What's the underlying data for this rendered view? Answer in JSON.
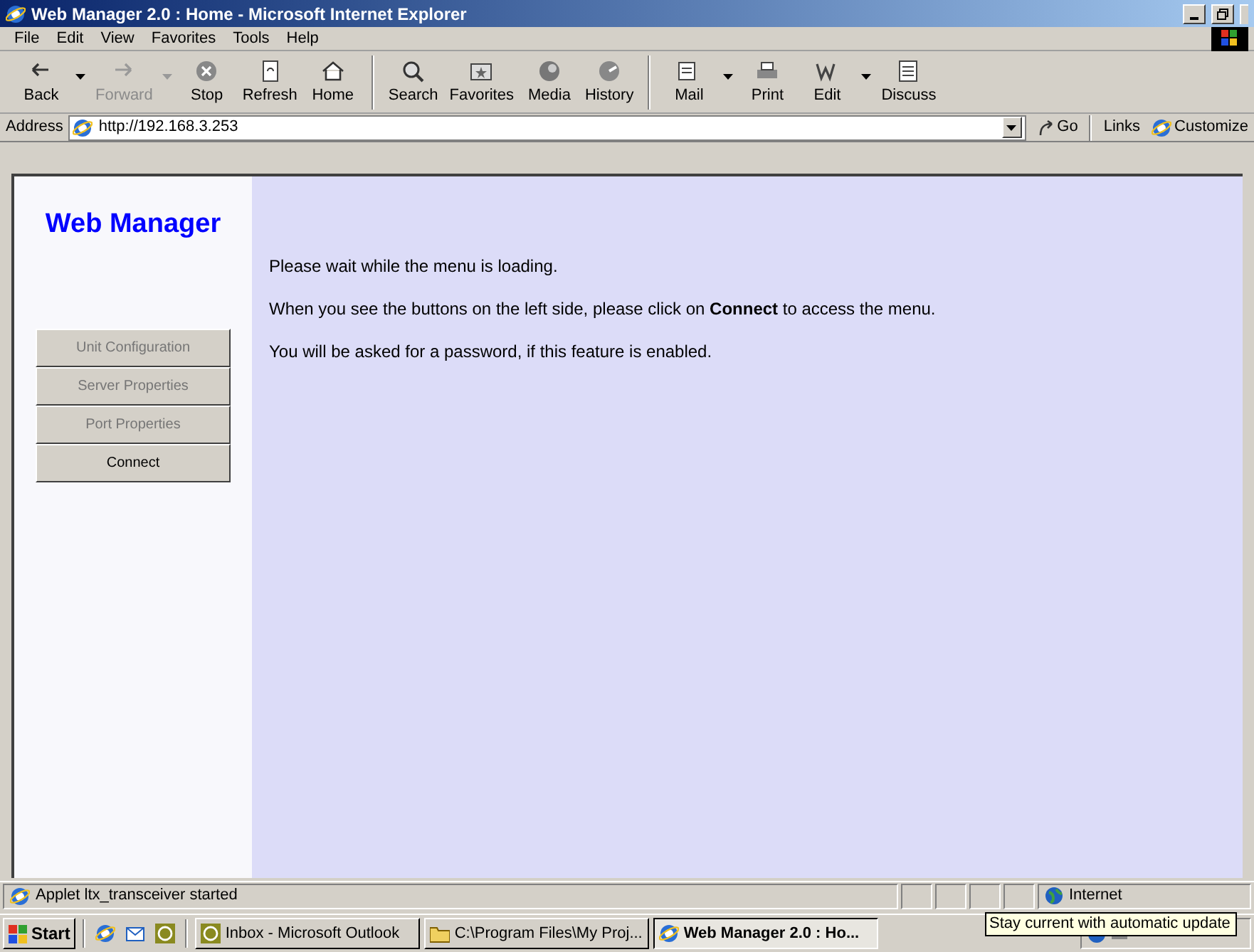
{
  "window": {
    "title": "Web Manager 2.0 : Home - Microsoft Internet Explorer"
  },
  "menu": [
    "File",
    "Edit",
    "View",
    "Favorites",
    "Tools",
    "Help"
  ],
  "toolbar": [
    {
      "label": "Back",
      "disabled": false,
      "has_menu": true
    },
    {
      "label": "Forward",
      "disabled": true,
      "has_menu": true
    },
    {
      "label": "Stop",
      "disabled": false,
      "has_menu": false
    },
    {
      "label": "Refresh",
      "disabled": false,
      "has_menu": false
    },
    {
      "label": "Home",
      "disabled": false,
      "has_menu": false
    },
    {
      "label": "Search",
      "disabled": false,
      "has_menu": false
    },
    {
      "label": "Favorites",
      "disabled": false,
      "has_menu": false
    },
    {
      "label": "Media",
      "disabled": false,
      "has_menu": false
    },
    {
      "label": "History",
      "disabled": false,
      "has_menu": false
    },
    {
      "label": "Mail",
      "disabled": false,
      "has_menu": true
    },
    {
      "label": "Print",
      "disabled": false,
      "has_menu": false
    },
    {
      "label": "Edit",
      "disabled": false,
      "has_menu": true
    },
    {
      "label": "Discuss",
      "disabled": false,
      "has_menu": false
    }
  ],
  "address_bar": {
    "label": "Address",
    "value": "http://192.168.3.253",
    "go": "Go",
    "links": "Links",
    "customize": "Customize"
  },
  "page": {
    "logo": "Web Manager",
    "nav": [
      {
        "label": "Unit Configuration",
        "disabled": true
      },
      {
        "label": "Server Properties",
        "disabled": true
      },
      {
        "label": "Port Properties",
        "disabled": true
      },
      {
        "label": "Connect",
        "disabled": false
      }
    ],
    "paragraphs": [
      "Please wait while the menu is loading.",
      "When you see the buttons on the left side, please click on **Connect** to access the menu.",
      "You will be asked for a password, if this feature is enabled."
    ]
  },
  "status_bar": {
    "text": "Applet ltx_transceiver started",
    "zone": "Internet"
  },
  "taskbar": {
    "start": "Start",
    "tasks": [
      {
        "label": "Inbox - Microsoft Outlook",
        "selected": false
      },
      {
        "label": "C:\\Program Files\\My Proj...",
        "selected": false
      },
      {
        "label": "Web Manager 2.0 : Ho...",
        "selected": true
      }
    ],
    "tooltip": "Stay current with automatic update"
  }
}
